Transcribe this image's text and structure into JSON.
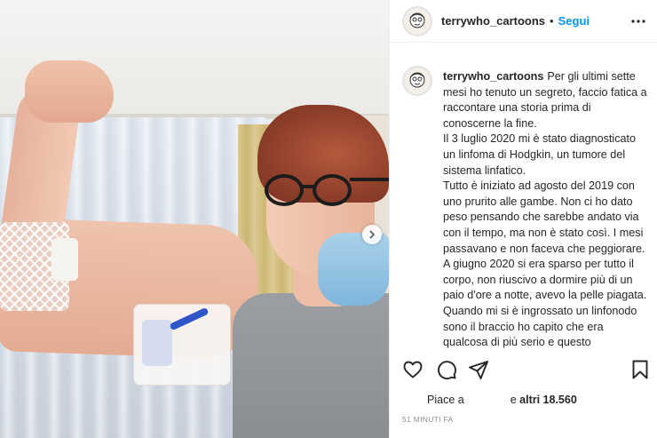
{
  "post": {
    "username": "terrywho_cartoons",
    "separator": "•",
    "follow_label": "Segui",
    "caption_paragraphs": [
      "Per gli ultimi sette mesi ho tenuto un segreto, faccio fatica a raccontare una storia prima di conoscerne la fine.",
      "Il 3 luglio 2020 mi è stato diagnosticato un linfoma di Hodgkin, un tumore del sistema linfatico.",
      "Tutto è iniziato ad agosto del 2019 con uno prurito alle gambe. Non ci ho dato peso pensando che sarebbe andato via con il tempo, ma non è stato così. I mesi passavano e non faceva che peggiorare. A giugno 2020 si era sparso per tutto il corpo, non riuscivo a dormire più di un paio d'ore a notte, avevo la pelle piagata.",
      "Quando mi si è ingrossato un linfonodo sono il braccio ho capito che era qualcosa di più serio e questo"
    ],
    "likes_prefix": "Piace a",
    "likes_suffix_plain": "e ",
    "likes_suffix_bold": "altri 18.560",
    "timestamp": "51 MINUTI FA"
  },
  "icons": {
    "more": "more-options-icon",
    "like": "heart-icon",
    "comment": "comment-icon",
    "share": "share-icon",
    "save": "bookmark-icon",
    "carousel": "chevron-right-icon"
  },
  "colors": {
    "follow": "#0095f6",
    "text": "#262626",
    "muted": "#8e8e8e"
  }
}
